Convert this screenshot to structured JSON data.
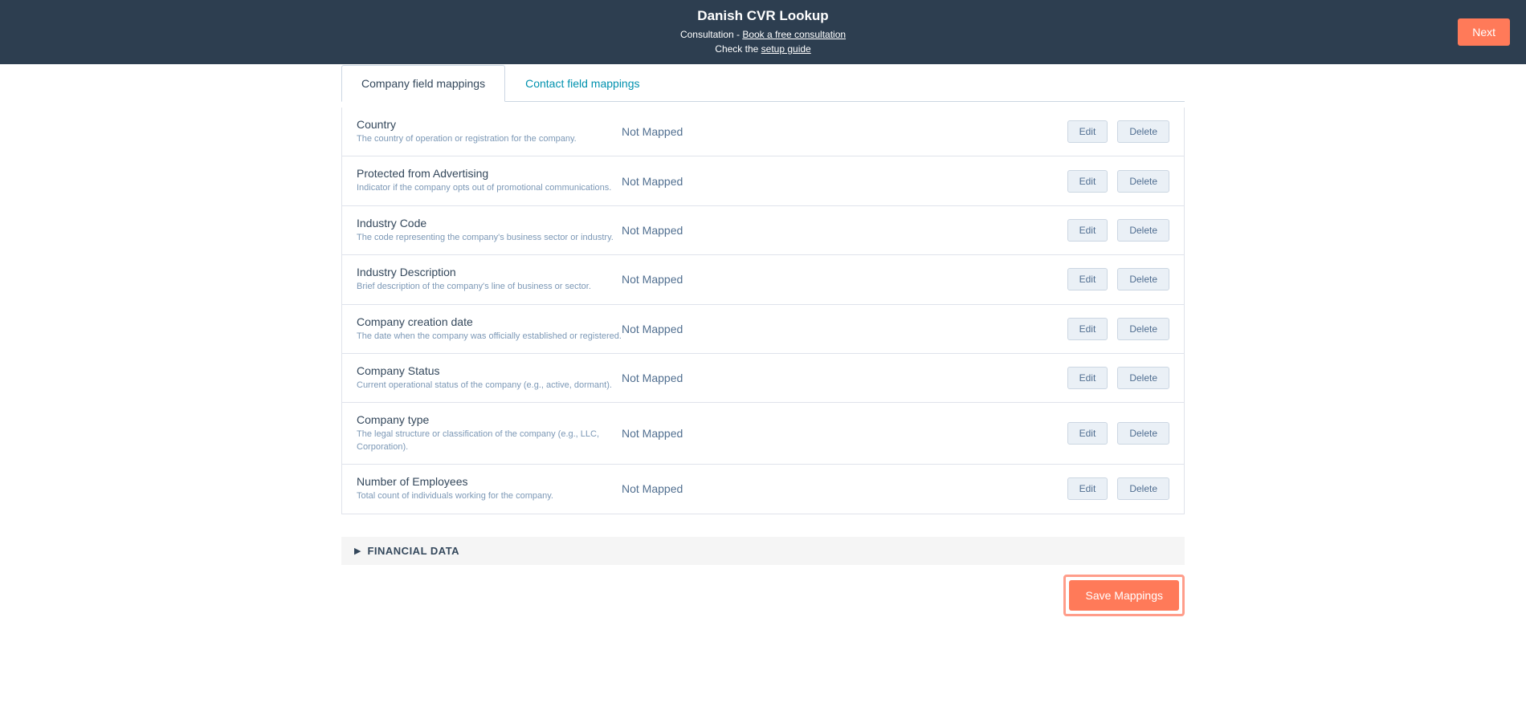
{
  "header": {
    "title": "Danish CVR Lookup",
    "consultation_prefix": "Consultation - ",
    "consultation_link": "Book a free consultation",
    "check_prefix": "Check the ",
    "setup_link": "setup guide",
    "next": "Next"
  },
  "tabs": {
    "company": "Company field mappings",
    "contact": "Contact field mappings"
  },
  "status_text": "Not Mapped",
  "buttons": {
    "edit": "Edit",
    "delete": "Delete",
    "save": "Save Mappings"
  },
  "rows": [
    {
      "name": "Country",
      "desc": "The country of operation or registration for the company."
    },
    {
      "name": "Protected from Advertising",
      "desc": "Indicator if the company opts out of promotional communications."
    },
    {
      "name": "Industry Code",
      "desc": "The code representing the company's business sector or industry."
    },
    {
      "name": "Industry Description",
      "desc": "Brief description of the company's line of business or sector."
    },
    {
      "name": "Company creation date",
      "desc": "The date when the company was officially established or registered."
    },
    {
      "name": "Company Status",
      "desc": "Current operational status of the company (e.g., active, dormant)."
    },
    {
      "name": "Company type",
      "desc": "The legal structure or classification of the company (e.g., LLC, Corporation)."
    },
    {
      "name": "Number of Employees",
      "desc": "Total count of individuals working for the company."
    }
  ],
  "accordion": {
    "title": "FINANCIAL DATA"
  }
}
